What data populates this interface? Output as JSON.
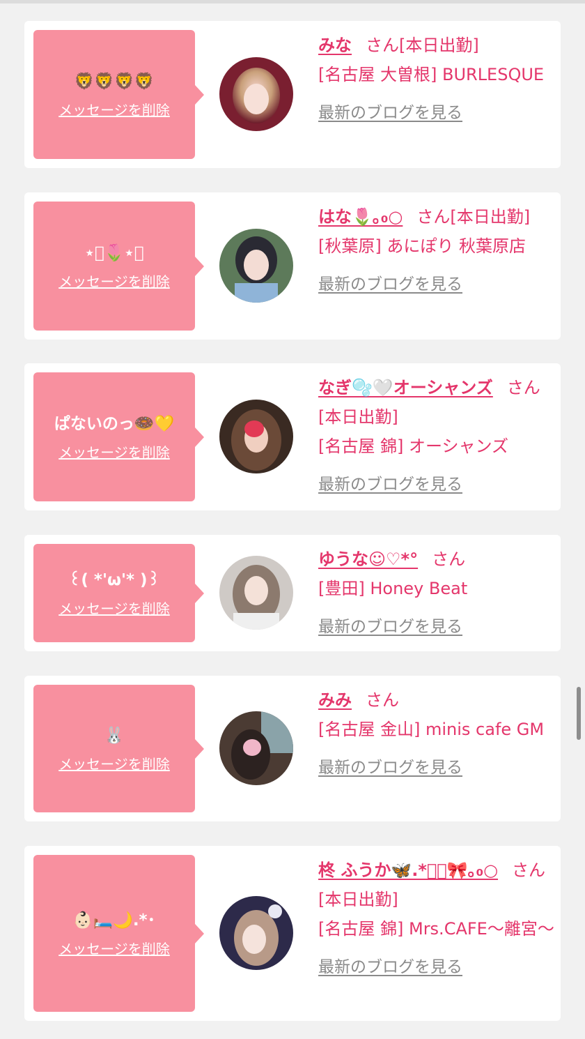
{
  "delete_label": "メッセージを削除",
  "blog_label": "最新のブログを見る",
  "san_label": "さん",
  "colors": {
    "accent": "#e4366b",
    "bubble": "#f8909f",
    "background": "#f1f1f1",
    "blog_link": "#8a8a8a"
  },
  "cards": [
    {
      "message": "🦁🦁🦁🦁",
      "name": "みな",
      "status": "[本日出勤]",
      "shop": "[名古屋 大曽根] BURLESQUE",
      "avatar_icon": "avatar-photo"
    },
    {
      "message": "⋆͛🌷⋆͛",
      "name": "はな🌷｡₀○",
      "status": "[本日出勤]",
      "shop": "[秋葉原] あにぽり 秋葉原店",
      "avatar_icon": "avatar-photo"
    },
    {
      "message": "ぱないのっ🍩💛",
      "name": "なぎ🫧🤍オーシャンズ",
      "status": "[本日出勤]",
      "shop": "[名古屋 錦] オーシャンズ",
      "avatar_icon": "avatar-photo"
    },
    {
      "message": "꒰( *'ω'* )꒱",
      "name": "ゆうな☺︎♡*°",
      "status": "",
      "shop": "[豊田] Honey Beat",
      "avatar_icon": "avatar-photo"
    },
    {
      "message": "🐰",
      "name": "みみ",
      "status": "",
      "shop": "[名古屋 金山] minis cafe GM",
      "avatar_icon": "avatar-photo"
    },
    {
      "message": "👶🏻🛏️🌙.*･",
      "name": "柊 ふうか🦋.*ﾟ＿🎀｡₀○",
      "status": "[本日出勤]",
      "shop": "[名古屋 錦] Mrs.CAFE〜離宮〜",
      "avatar_icon": "avatar-photo"
    }
  ]
}
